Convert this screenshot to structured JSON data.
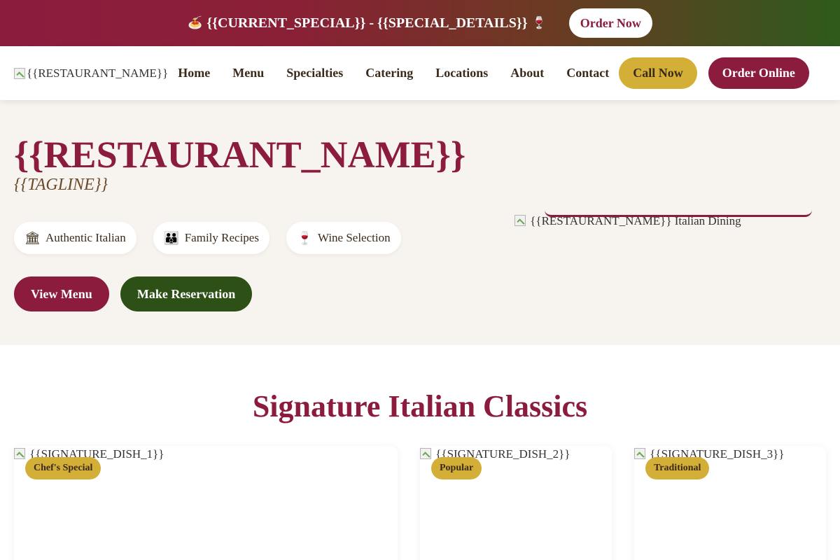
{
  "promo": {
    "emoji_left": "🍝",
    "text": "{{CURRENT_SPECIAL}} - {{SPECIAL_DETAILS}}",
    "emoji_right": "🍷",
    "button_label": "Order Now"
  },
  "header": {
    "logo_alt": "{{RESTAURANT_NAME}}",
    "nav": [
      "Home",
      "Menu",
      "Specialties",
      "Catering",
      "Locations",
      "About",
      "Contact"
    ],
    "call_label": "Call Now",
    "order_label": "Order Online"
  },
  "hero": {
    "title": "{{RESTAURANT_NAME}}",
    "tagline": "{{TAGLINE}}",
    "features": [
      {
        "icon": "🏛",
        "icon_name": "columns-icon",
        "label": "Authentic Italian"
      },
      {
        "icon": "👪",
        "icon_name": "family-icon",
        "label": "Family Recipes"
      },
      {
        "icon": "🍷",
        "icon_name": "wine-glass-icon",
        "label": "Wine Selection"
      }
    ],
    "view_menu_label": "View Menu",
    "reserve_label": "Make Reservation",
    "image_alt": "{{RESTAURANT_NAME}} Italian Dining"
  },
  "signature": {
    "title": "Signature Italian Classics",
    "dishes": [
      {
        "image_alt": "{{SIGNATURE_DISH_1}}",
        "badge": "Chef's Special"
      },
      {
        "image_alt": "{{SIGNATURE_DISH_2}}",
        "badge": "Popular"
      },
      {
        "image_alt": "{{SIGNATURE_DISH_3}}",
        "badge": "Traditional"
      }
    ]
  },
  "colors": {
    "burgundy": "#8c1c3e",
    "gold": "#d4af37",
    "olive_green": "#2d5016",
    "cream": "#f7f3ef"
  }
}
